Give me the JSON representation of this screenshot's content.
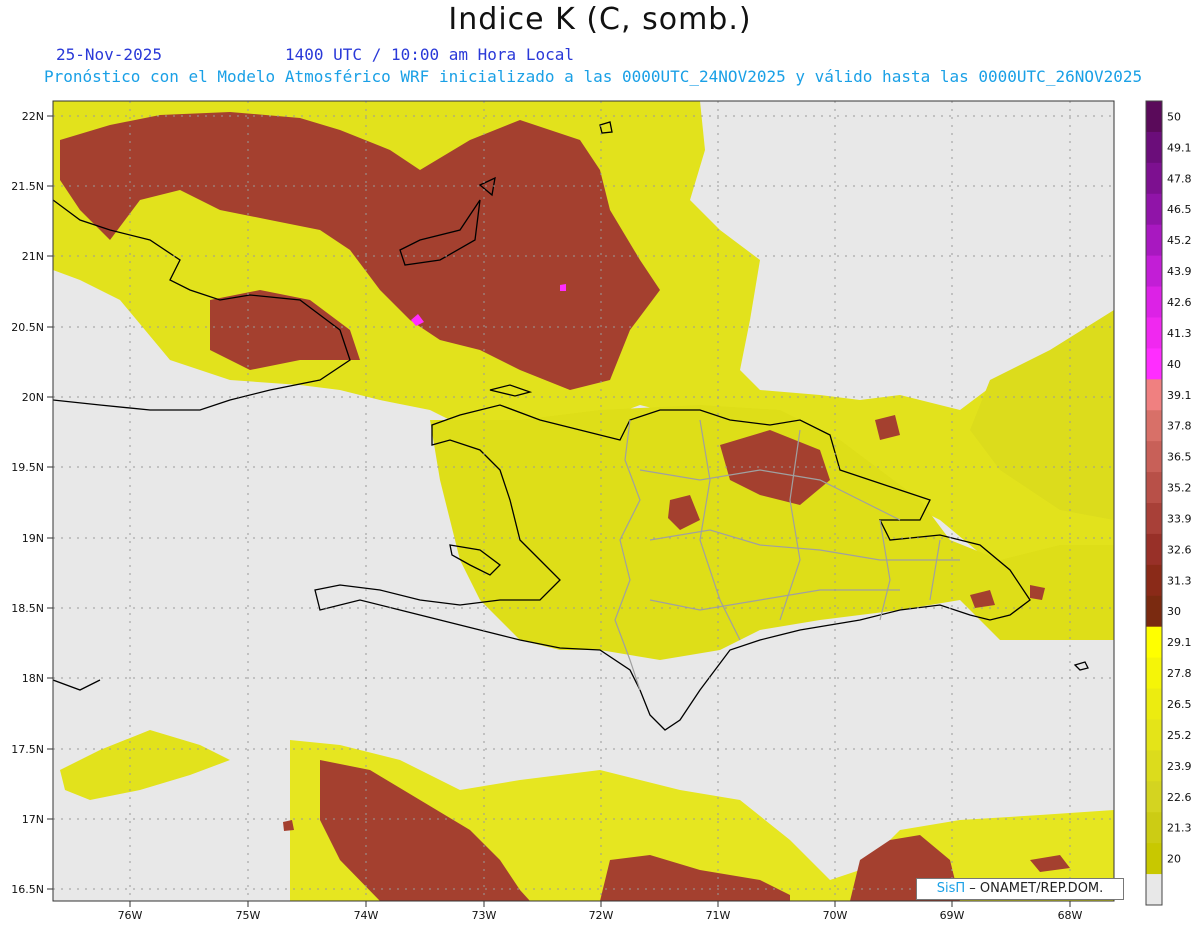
{
  "header": {
    "title": "Indice K (C, somb.)",
    "date": "25-Nov-2025",
    "time": "1400 UTC / 10:00 am Hora Local",
    "description": "Pronóstico con el Modelo Atmosférico WRF inicializado a las 0000UTC_24NOV2025 y válido hasta las  0000UTC_26NOV2025"
  },
  "map": {
    "lat_labels": [
      "22N",
      "21.5N",
      "21N",
      "20.5N",
      "20N",
      "19.5N",
      "19N",
      "18.5N",
      "18N",
      "17.5N",
      "17N",
      "16.5N"
    ],
    "lon_labels": [
      "76W",
      "75W",
      "74W",
      "73W",
      "72W",
      "71W",
      "70W",
      "69W",
      "68W"
    ],
    "background_color": "#e8e8e8"
  },
  "colorbar": {
    "labels": [
      "50",
      "49.1",
      "47.8",
      "46.5",
      "45.2",
      "43.9",
      "42.6",
      "41.3",
      "40",
      "39.1",
      "37.8",
      "36.5",
      "35.2",
      "33.9",
      "32.6",
      "31.3",
      "30",
      "29.1",
      "27.8",
      "26.5",
      "25.2",
      "23.9",
      "22.6",
      "21.3",
      "20"
    ],
    "colors": [
      "#5a0a5a",
      "#6b0d7a",
      "#7d1090",
      "#9014a8",
      "#a818c0",
      "#c21ed6",
      "#dc22e6",
      "#f028f0",
      "#ff2dff",
      "#f08080",
      "#d87068",
      "#c86058",
      "#b85048",
      "#a84038",
      "#983028",
      "#8a2a18",
      "#7a2a10",
      "#ffff00",
      "#f5f508",
      "#ecec10",
      "#e4e418",
      "#dcdc1c",
      "#d4d420",
      "#cccc14",
      "#c8c800",
      "#e8e8e8"
    ]
  },
  "credit": {
    "sis": "SisΠ",
    "org": " – ONAMET/REP.DOM."
  }
}
